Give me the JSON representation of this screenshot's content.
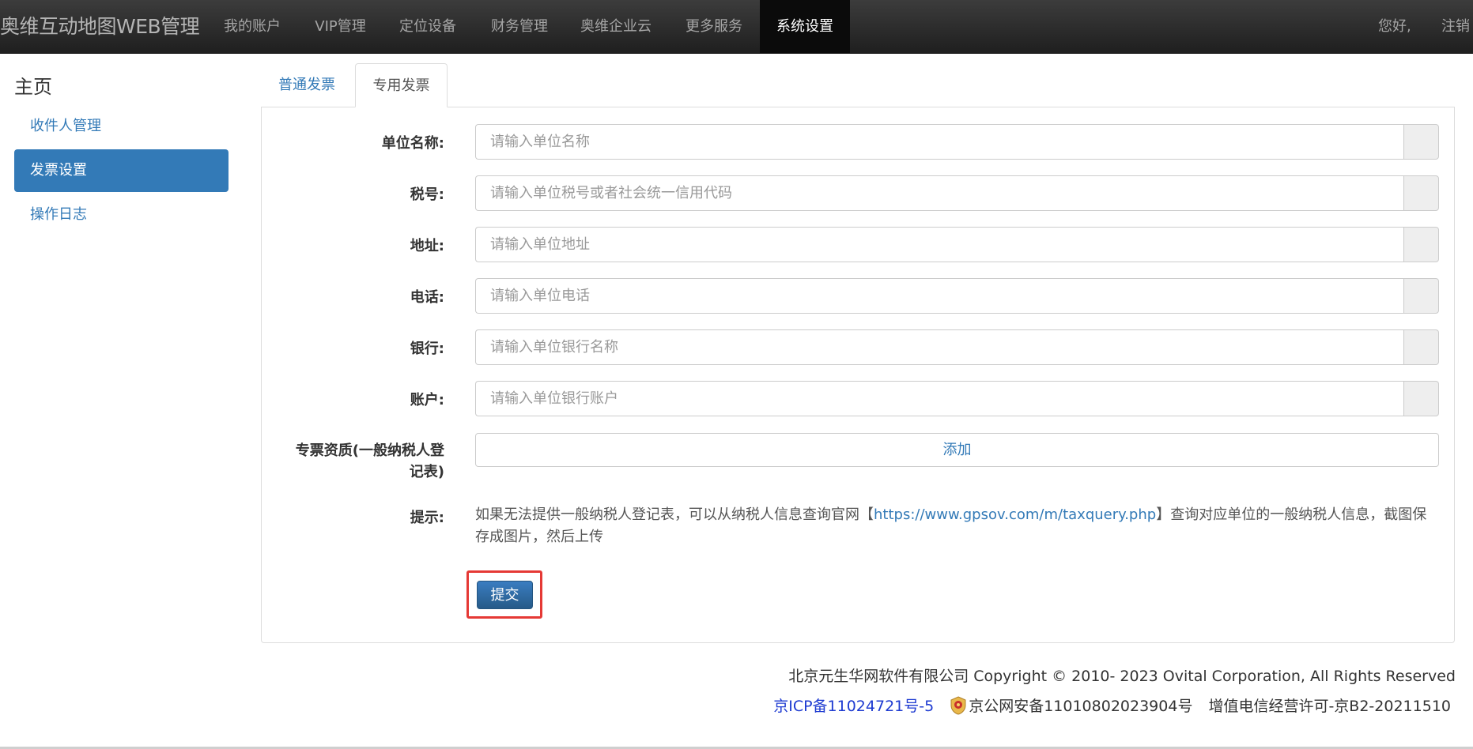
{
  "navbar": {
    "brand": "奥维互动地图WEB管理",
    "items": [
      "我的账户",
      "VIP管理",
      "定位设备",
      "财务管理",
      "奥维企业云",
      "更多服务",
      "系统设置"
    ],
    "greeting": "您好,",
    "logout": "注销"
  },
  "sidebar": {
    "title": "主页",
    "items": [
      "收件人管理",
      "发票设置",
      "操作日志"
    ]
  },
  "tabs": [
    "普通发票",
    "专用发票"
  ],
  "form": {
    "fields": [
      {
        "label": "单位名称:",
        "placeholder": "请输入单位名称",
        "value": ""
      },
      {
        "label": "税号:",
        "placeholder": "请输入单位税号或者社会统一信用代码",
        "value": ""
      },
      {
        "label": "地址:",
        "placeholder": "请输入单位地址",
        "value": ""
      },
      {
        "label": "电话:",
        "placeholder": "请输入单位电话",
        "value": ""
      },
      {
        "label": "银行:",
        "placeholder": "请输入单位银行名称",
        "value": ""
      },
      {
        "label": "账户:",
        "placeholder": "请输入单位银行账户",
        "value": ""
      }
    ],
    "qualification_label_line1": "专票资质(一般纳税人登",
    "qualification_label_line2": "记表)",
    "add_label": "添加",
    "hint_label": "提示:",
    "hint_before": "如果无法提供一般纳税人登记表，可以从纳税人信息查询官网【",
    "hint_link": "https://www.gpsov.com/m/taxquery.php",
    "hint_after": "】查询对应单位的一般纳税人信息，截图保存成图片，然后上传",
    "submit_label": "提交"
  },
  "footer": {
    "copyright": "北京元生华网软件有限公司 Copyright © 2010- 2023 Ovital Corporation, All Rights Reserved",
    "icp": "京ICP备11024721号-5",
    "police": "京公网安备11010802023904号",
    "license": "增值电信经营许可-京B2-20211510"
  },
  "colors": {
    "accent": "#337ab7",
    "navbar": "#222222",
    "highlight": "#e53935"
  }
}
